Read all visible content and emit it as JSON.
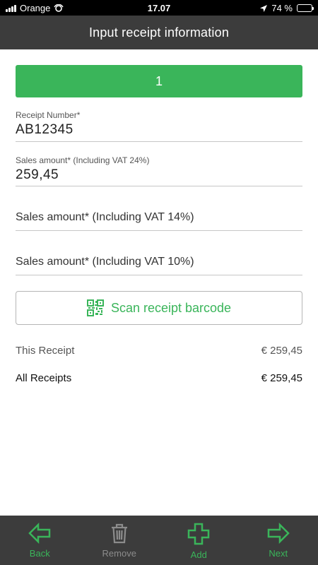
{
  "status_bar": {
    "carrier": "Orange",
    "time": "17.07",
    "battery": "74 %",
    "battery_level": 0.74
  },
  "header": {
    "title": "Input receipt information"
  },
  "receipt_tab": {
    "label": "1"
  },
  "form": {
    "receipt_number": {
      "label": "Receipt Number*",
      "value": "AB12345"
    },
    "sales_24": {
      "label": "Sales amount*",
      "note": "(Including VAT 24%)",
      "value": "259,45"
    },
    "sales_14": {
      "label": "Sales amount*",
      "note": "(Including VAT 14%)"
    },
    "sales_10": {
      "label": "Sales amount*",
      "note": "(Including VAT 10%)"
    }
  },
  "scan_button": {
    "label": "Scan receipt barcode",
    "icon": "qr-code-icon"
  },
  "totals": {
    "this_receipt": {
      "label": "This Receipt",
      "value": "€ 259,45"
    },
    "all_receipts": {
      "label": "All Receipts",
      "value": "€ 259,45"
    }
  },
  "toolbar": {
    "back": {
      "label": "Back",
      "icon": "arrow-left-icon"
    },
    "remove": {
      "label": "Remove",
      "icon": "trash-icon"
    },
    "add": {
      "label": "Add",
      "icon": "plus-icon"
    },
    "next": {
      "label": "Next",
      "icon": "arrow-right-icon"
    }
  },
  "colors": {
    "accent": "#3ab55a",
    "bar": "#3c3c3c",
    "disabled": "#8c8c8c"
  }
}
